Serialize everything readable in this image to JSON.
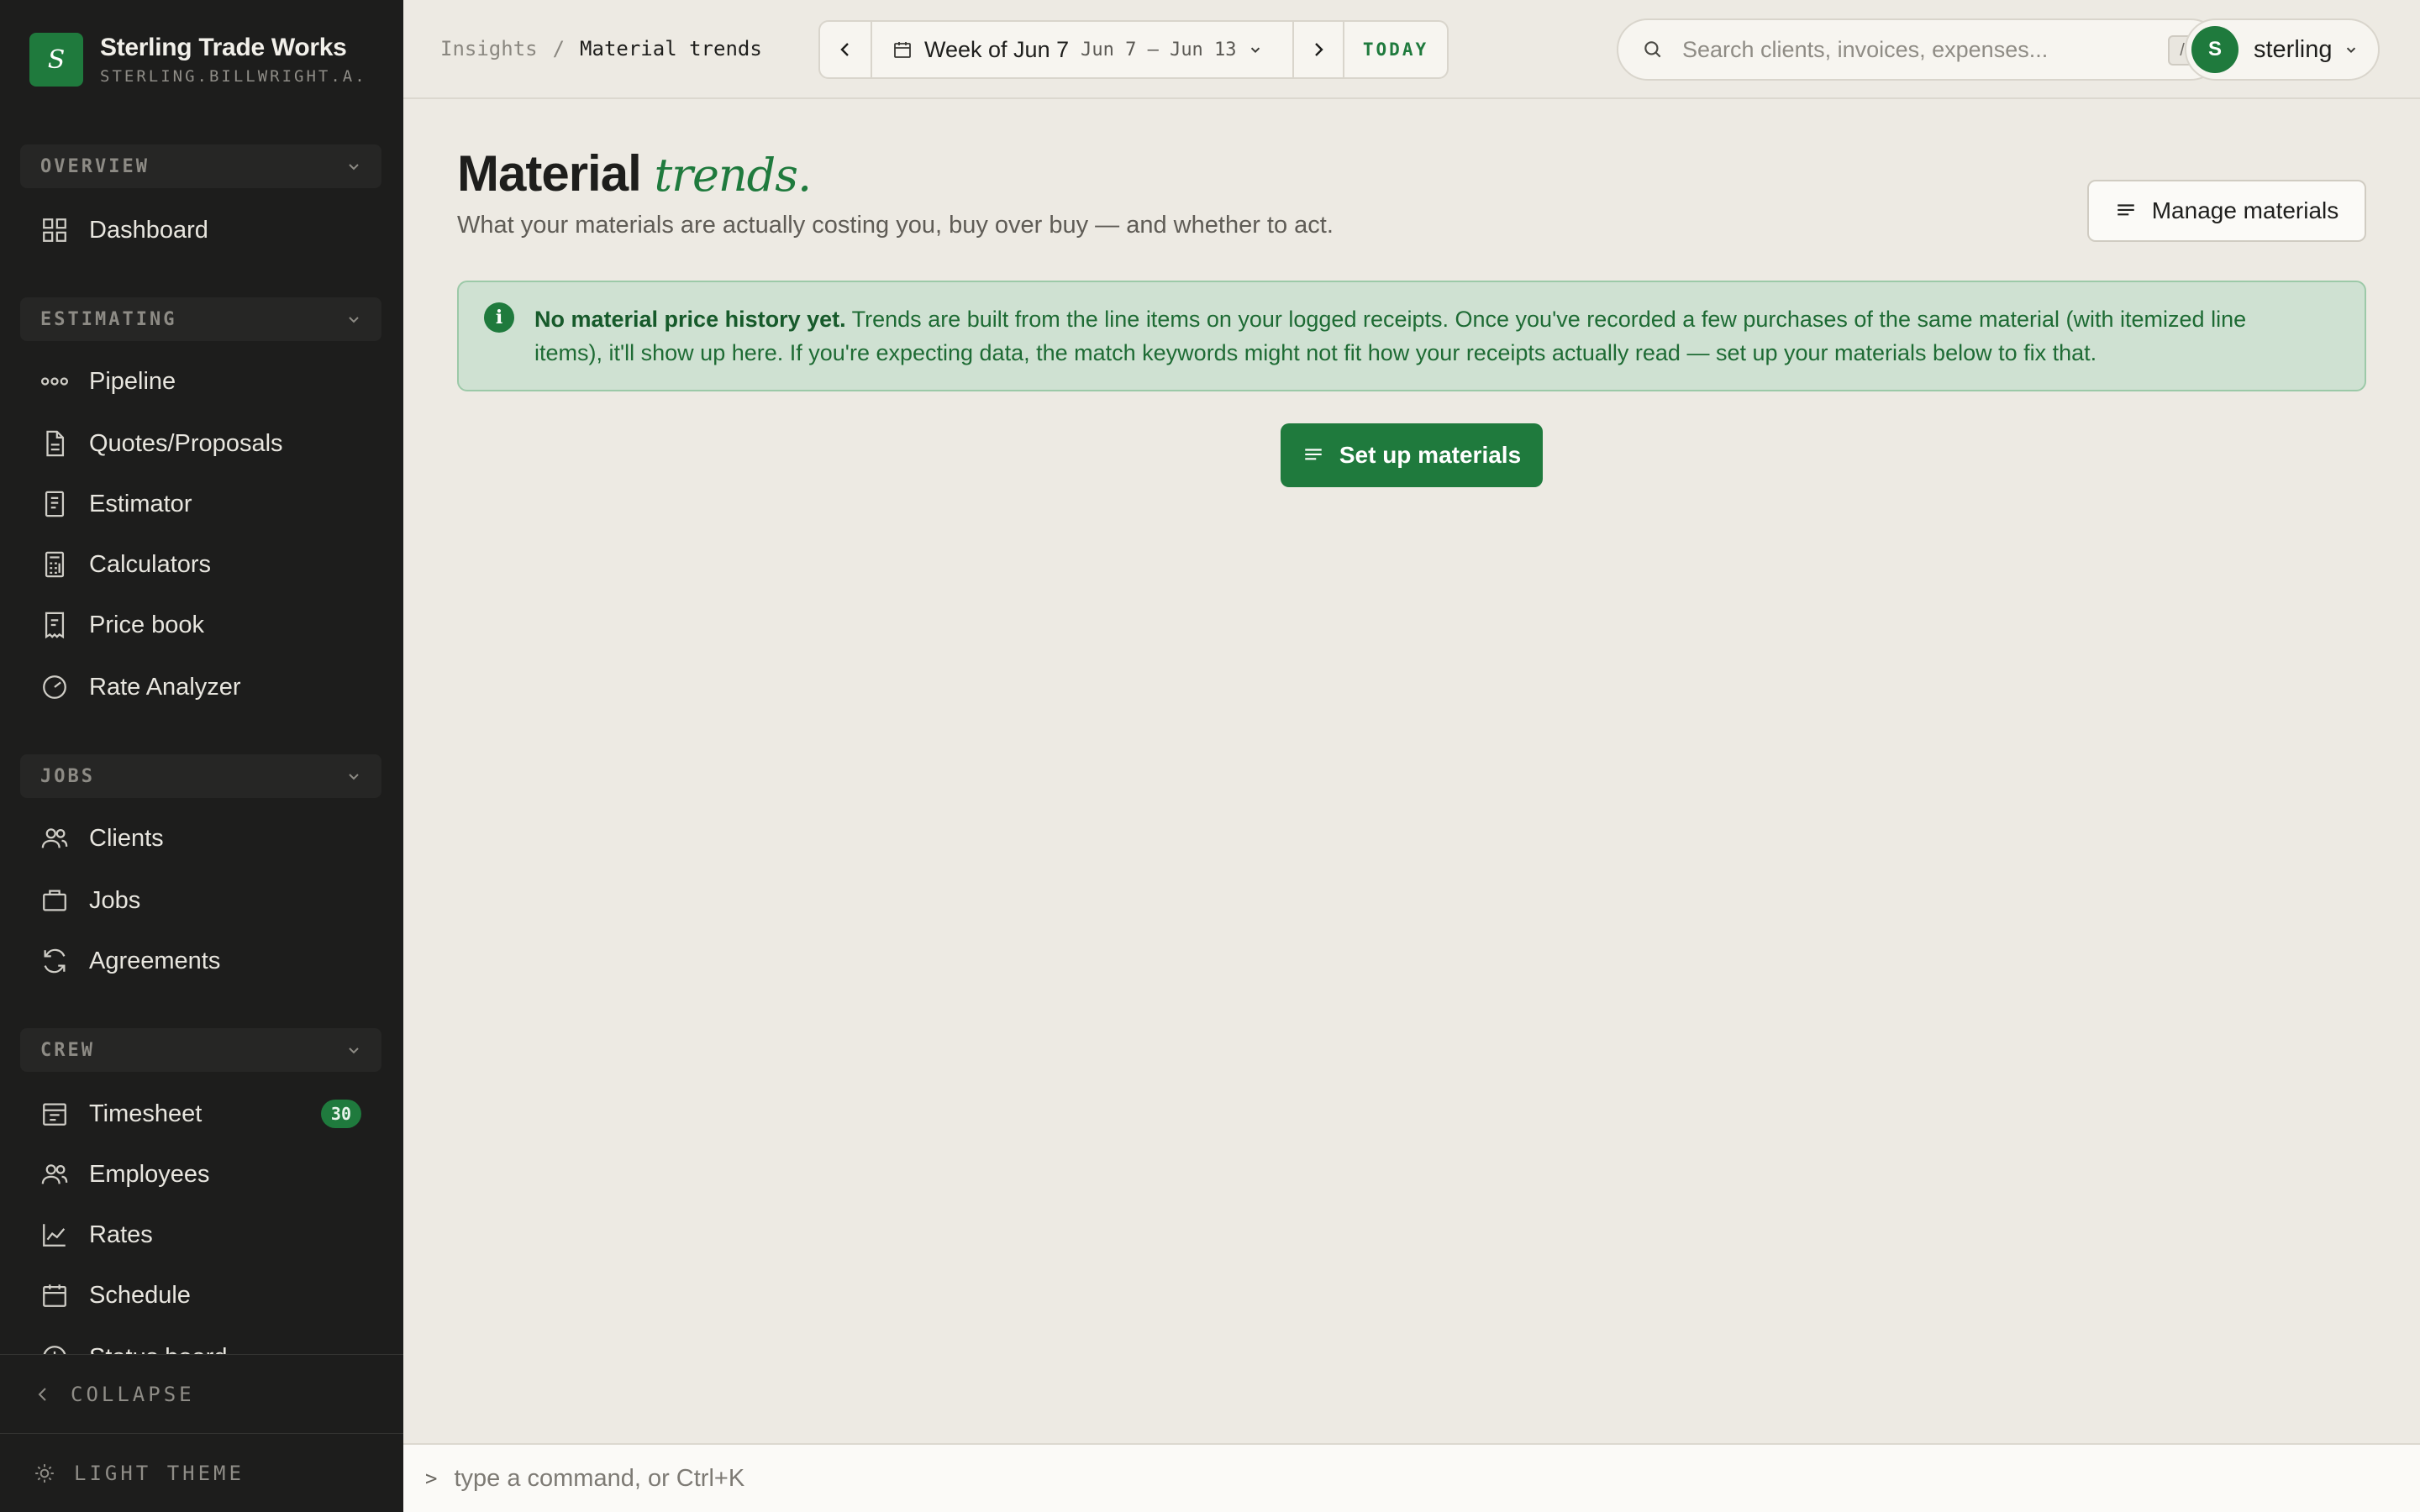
{
  "brand": {
    "logo_letter": "S",
    "name": "Sterling Trade Works",
    "subdomain": "STERLING.BILLWRIGHT.A..."
  },
  "sidebar": {
    "sections": [
      {
        "label": "OVERVIEW",
        "items": [
          {
            "label": "Dashboard",
            "icon": "grid-icon"
          }
        ]
      },
      {
        "label": "ESTIMATING",
        "items": [
          {
            "label": "Pipeline",
            "icon": "pipeline-icon"
          },
          {
            "label": "Quotes/Proposals",
            "icon": "document-icon"
          },
          {
            "label": "Estimator",
            "icon": "estimator-icon"
          },
          {
            "label": "Calculators",
            "icon": "calculator-icon"
          },
          {
            "label": "Price book",
            "icon": "price-book-icon"
          },
          {
            "label": "Rate Analyzer",
            "icon": "gauge-icon"
          }
        ]
      },
      {
        "label": "JOBS",
        "items": [
          {
            "label": "Clients",
            "icon": "users-icon"
          },
          {
            "label": "Jobs",
            "icon": "briefcase-icon"
          },
          {
            "label": "Agreements",
            "icon": "refresh-icon"
          }
        ]
      },
      {
        "label": "CREW",
        "items": [
          {
            "label": "Timesheet",
            "icon": "timesheet-icon",
            "badge": "30"
          },
          {
            "label": "Employees",
            "icon": "users-icon"
          },
          {
            "label": "Rates",
            "icon": "chart-line-icon"
          },
          {
            "label": "Schedule",
            "icon": "calendar-icon"
          },
          {
            "label": "Status board",
            "icon": "clock-icon"
          }
        ]
      }
    ],
    "collapse_label": "COLLAPSE",
    "theme_label": "LIGHT THEME"
  },
  "topbar": {
    "breadcrumb": [
      "Insights",
      "Material trends"
    ],
    "breadcrumb_separator": "/",
    "week": {
      "title": "Week of Jun 7",
      "range": "Jun 7 – Jun 13",
      "today_label": "TODAY"
    },
    "search": {
      "placeholder": "Search clients, invoices, expenses...",
      "shortcut": "/"
    },
    "user": {
      "initial": "S",
      "name": "sterling"
    }
  },
  "page": {
    "title": "Material",
    "title_accent": "trends.",
    "subtitle": "What your materials are actually costing you, buy over buy — and whether to act.",
    "manage_button": "Manage materials",
    "notice": {
      "heading": "No material price history yet.",
      "body": "Trends are built from the line items on your logged receipts. Once you've recorded a few purchases of the same material (with itemized line items), it'll show up here. If you're expecting data, the match keywords might not fit how your receipts actually read — set up your materials below to fix that."
    },
    "setup_button": "Set up materials"
  },
  "command_bar": {
    "prompt": ">",
    "placeholder": "type a command, or Ctrl+K"
  },
  "colors": {
    "accent": "#1f7a3d",
    "sidebar_bg": "#1d1d1c",
    "page_bg": "#edeae3",
    "notice_bg": "#cfe1d2"
  }
}
